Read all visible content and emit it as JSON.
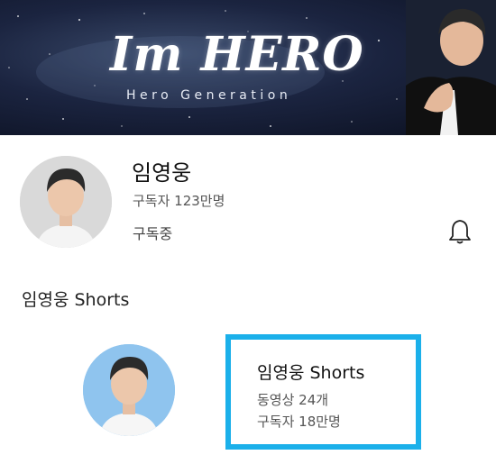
{
  "banner": {
    "title": "Im HERO",
    "subtitle": "Hero Generation"
  },
  "channel": {
    "name": "임영웅",
    "subscribers": "구독자 123만명",
    "status": "구독중",
    "bell_icon": "bell-icon"
  },
  "shorts_section": {
    "title": "임영웅 Shorts",
    "card": {
      "name": "임영웅 Shorts",
      "videos": "동영상 24개",
      "subscribers": "구독자 18만명"
    }
  },
  "colors": {
    "highlight_border": "#1bb0ea",
    "shorts_avatar_bg": "#8fc4ee",
    "channel_avatar_bg": "#d9d9d9"
  }
}
